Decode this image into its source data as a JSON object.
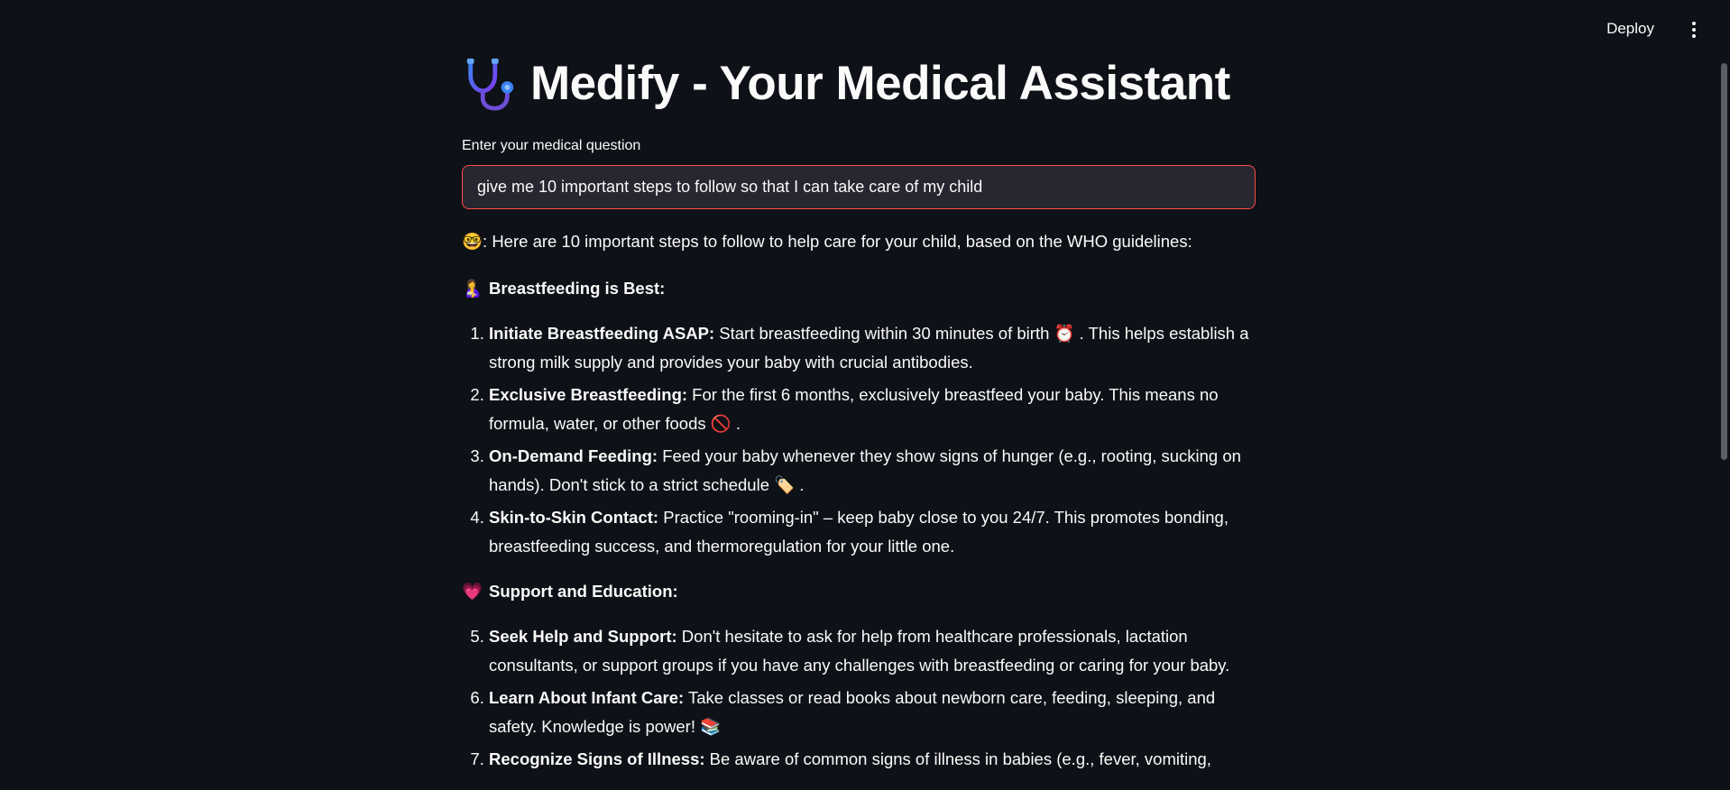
{
  "header": {
    "deploy_label": "Deploy",
    "menu_icon": "vertical-ellipsis-icon"
  },
  "app": {
    "title_icon": "stethoscope-icon",
    "title": "Medify - Your Medical Assistant"
  },
  "question": {
    "label": "Enter your medical question",
    "value": "give me 10 important steps to follow so that I can take care of my child"
  },
  "response": {
    "intro_icon": "🤓",
    "intro_text": ": Here are 10 important steps to follow to help care for your child, based on the WHO guidelines:",
    "sections": [
      {
        "icon": "🤱",
        "heading": "Breastfeeding is Best:",
        "start": 1,
        "items": [
          {
            "bold": "Initiate Breastfeeding ASAP:",
            "text": " Start breastfeeding within 30 minutes of birth ⏰ . This helps establish a strong milk supply and provides your baby with crucial antibodies."
          },
          {
            "bold": "Exclusive Breastfeeding:",
            "text": " For the first 6 months, exclusively breastfeed your baby. This means no formula, water, or other foods 🚫 ."
          },
          {
            "bold": "On-Demand Feeding:",
            "text": " Feed your baby whenever they show signs of hunger (e.g., rooting, sucking on hands). Don't stick to a strict schedule 🏷️ ."
          },
          {
            "bold": "Skin-to-Skin Contact:",
            "text": " Practice \"rooming-in\" – keep baby close to you 24/7. This promotes bonding, breastfeeding success, and thermoregulation for your little one."
          }
        ]
      },
      {
        "icon": "💗",
        "heading": "Support and Education:",
        "start": 5,
        "items": [
          {
            "bold": "Seek Help and Support:",
            "text": " Don't hesitate to ask for help from healthcare professionals, lactation consultants, or support groups if you have any challenges with breastfeeding or caring for your baby."
          },
          {
            "bold": "Learn About Infant Care:",
            "text": " Take classes or read books about newborn care, feeding, sleeping, and safety. Knowledge is power! 📚"
          },
          {
            "bold": "Recognize Signs of Illness:",
            "text": " Be aware of common signs of illness in babies (e.g., fever, vomiting,"
          }
        ]
      }
    ]
  }
}
